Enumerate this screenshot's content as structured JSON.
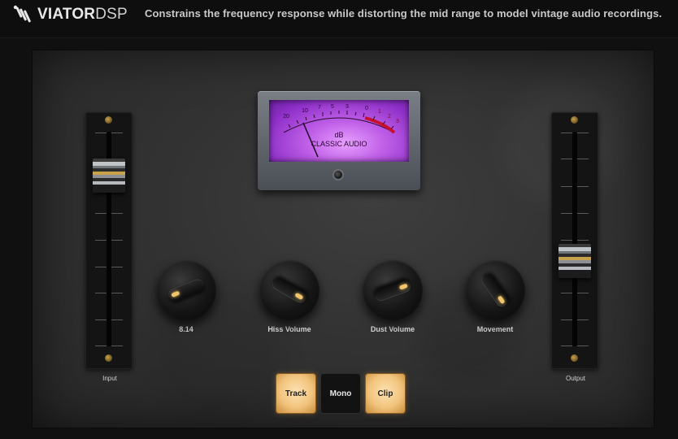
{
  "header": {
    "brand_bold": "VIATOR",
    "brand_light": "DSP",
    "tagline": "Constrains the frequency response while distorting the mid range to model vintage audio recordings."
  },
  "meter": {
    "unit": "dB",
    "name": "CLASSIC AUDIO",
    "scale": [
      "20",
      "10",
      "7",
      "5",
      "3",
      "0",
      "1",
      "2",
      "3"
    ]
  },
  "faders": {
    "input": {
      "label": "Input",
      "level": 0.85
    },
    "output": {
      "label": "Output",
      "level": 0.38
    }
  },
  "knobs": [
    {
      "label": "8.14"
    },
    {
      "label": "Hiss Volume"
    },
    {
      "label": "Dust Volume"
    },
    {
      "label": "Movement"
    }
  ],
  "buttons": {
    "track": {
      "label": "Track",
      "state": "on"
    },
    "mono": {
      "label": "Mono",
      "state": "off"
    },
    "clip": {
      "label": "Clip",
      "state": "on"
    }
  },
  "colors": {
    "accent": "#f2c56a",
    "meter_face": "#c060e8",
    "meter_red": "#c8102e"
  }
}
